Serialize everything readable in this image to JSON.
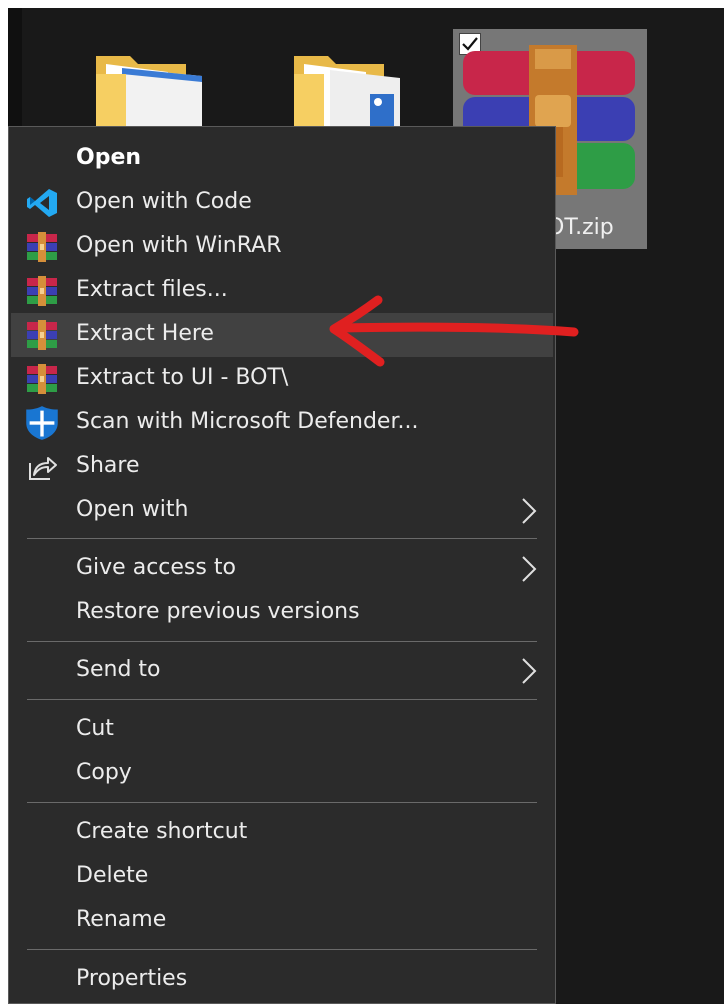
{
  "desktop": {
    "zip_file_name": "OT.zip"
  },
  "menu": {
    "items": [
      {
        "label": "Open",
        "icon": "none"
      },
      {
        "label": "Open with Code",
        "icon": "vscode-icon"
      },
      {
        "label": "Open with WinRAR",
        "icon": "winrar-icon"
      },
      {
        "label": "Extract files...",
        "icon": "winrar-icon"
      },
      {
        "label": "Extract Here",
        "icon": "winrar-icon"
      },
      {
        "label": "Extract to UI - BOT\\",
        "icon": "winrar-icon"
      },
      {
        "label": "Scan with Microsoft Defender...",
        "icon": "defender-shield-icon"
      },
      {
        "label": "Share",
        "icon": "share-icon"
      },
      {
        "label": "Open with",
        "icon": "none"
      },
      {
        "label": "Give access to",
        "icon": "none"
      },
      {
        "label": "Restore previous versions",
        "icon": "none"
      },
      {
        "label": "Send to",
        "icon": "none"
      },
      {
        "label": "Cut",
        "icon": "none"
      },
      {
        "label": "Copy",
        "icon": "none"
      },
      {
        "label": "Create shortcut",
        "icon": "none"
      },
      {
        "label": "Delete",
        "icon": "none"
      },
      {
        "label": "Rename",
        "icon": "none"
      },
      {
        "label": "Properties",
        "icon": "none"
      }
    ]
  },
  "annotation": {
    "arrow_color": "#e02020",
    "highlighted_item": "Extract Here"
  },
  "colors": {
    "menu_bg": "#2b2b2b",
    "hover_bg": "#414141",
    "vscode_blue": "#23a9f2",
    "defender_blue": "#1976d2"
  }
}
